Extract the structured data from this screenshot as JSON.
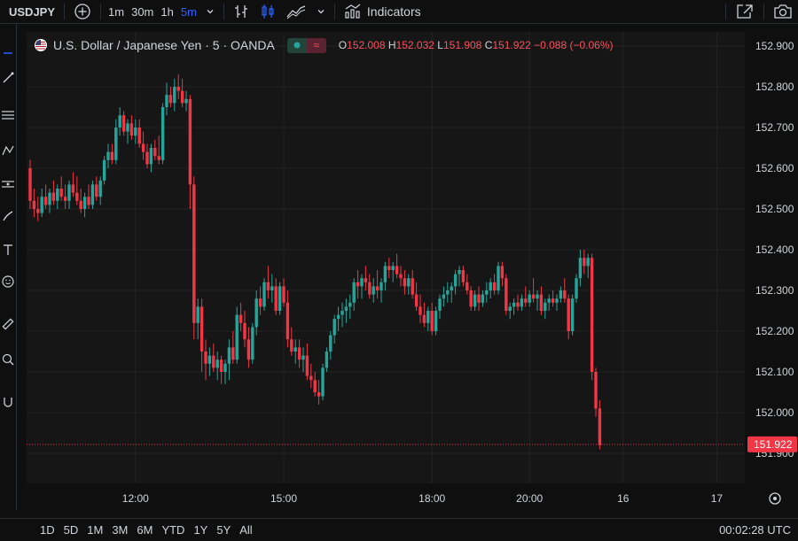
{
  "toolbar": {
    "symbol": "USDJPY",
    "intervals": [
      "1m",
      "30m",
      "1h",
      "5m"
    ],
    "active_interval": "5m",
    "indicators_label": "Indicators"
  },
  "legend": {
    "title": "U.S. Dollar / Japanese Yen · 5 · OANDA",
    "open_key": "O",
    "open": "152.008",
    "high_key": "H",
    "high": "152.032",
    "low_key": "L",
    "low": "151.908",
    "close_key": "C",
    "close": "151.922",
    "change": "−0.088 (−0.06%)",
    "badge_symbol": "≈"
  },
  "ranges": [
    "1D",
    "5D",
    "1M",
    "3M",
    "6M",
    "YTD",
    "1Y",
    "5Y",
    "All"
  ],
  "clock": "00:02:28 UTC",
  "colors": {
    "up": "#26a69a",
    "down": "#f23645",
    "accent": "#2962ff",
    "price_tag": "#f23645"
  },
  "chart_data": {
    "type": "candlestick",
    "y_ticks": [
      "152.900",
      "152.800",
      "152.700",
      "152.600",
      "152.500",
      "152.400",
      "152.300",
      "152.200",
      "152.100",
      "152.000",
      "151.900"
    ],
    "y_range": [
      151.86,
      152.92
    ],
    "x_ticks": [
      {
        "label": "12:00",
        "index": 27
      },
      {
        "label": "15:00",
        "index": 65
      },
      {
        "label": "18:00",
        "index": 103
      },
      {
        "label": "20:00",
        "index": 128
      },
      {
        "label": "16",
        "index": 152
      },
      {
        "label": "17",
        "index": 176
      }
    ],
    "last_price": "151.922",
    "candles": [
      [
        152.6,
        152.62,
        152.5,
        152.52
      ],
      [
        152.52,
        152.55,
        152.48,
        152.5
      ],
      [
        152.5,
        152.53,
        152.47,
        152.49
      ],
      [
        152.49,
        152.55,
        152.48,
        152.53
      ],
      [
        152.53,
        152.56,
        152.5,
        152.51
      ],
      [
        152.51,
        152.55,
        152.49,
        152.54
      ],
      [
        152.54,
        152.57,
        152.51,
        152.52
      ],
      [
        152.52,
        152.56,
        152.5,
        152.55
      ],
      [
        152.55,
        152.58,
        152.52,
        152.53
      ],
      [
        152.53,
        152.56,
        152.5,
        152.52
      ],
      [
        152.52,
        152.57,
        152.5,
        152.56
      ],
      [
        152.56,
        152.59,
        152.53,
        152.54
      ],
      [
        152.54,
        152.58,
        152.51,
        152.52
      ],
      [
        152.52,
        152.55,
        152.49,
        152.5
      ],
      [
        152.5,
        152.54,
        152.48,
        152.53
      ],
      [
        152.53,
        152.56,
        152.5,
        152.51
      ],
      [
        152.51,
        152.57,
        152.5,
        152.56
      ],
      [
        152.56,
        152.58,
        152.52,
        152.53
      ],
      [
        152.53,
        152.58,
        152.51,
        152.57
      ],
      [
        152.57,
        152.63,
        152.56,
        152.62
      ],
      [
        152.62,
        152.66,
        152.6,
        152.64
      ],
      [
        152.64,
        152.66,
        152.61,
        152.62
      ],
      [
        152.62,
        152.72,
        152.61,
        152.7
      ],
      [
        152.7,
        152.75,
        152.68,
        152.73
      ],
      [
        152.73,
        152.74,
        152.68,
        152.69
      ],
      [
        152.69,
        152.72,
        152.66,
        152.71
      ],
      [
        152.71,
        152.73,
        152.67,
        152.68
      ],
      [
        152.68,
        152.72,
        152.66,
        152.7
      ],
      [
        152.7,
        152.72,
        152.65,
        152.66
      ],
      [
        152.66,
        152.69,
        152.62,
        152.64
      ],
      [
        152.64,
        152.66,
        152.6,
        152.61
      ],
      [
        152.61,
        152.66,
        152.59,
        152.65
      ],
      [
        152.65,
        152.67,
        152.62,
        152.63
      ],
      [
        152.63,
        152.68,
        152.61,
        152.62
      ],
      [
        152.62,
        152.76,
        152.61,
        152.75
      ],
      [
        152.75,
        152.81,
        152.73,
        152.78
      ],
      [
        152.78,
        152.8,
        152.75,
        152.76
      ],
      [
        152.76,
        152.82,
        152.74,
        152.8
      ],
      [
        152.8,
        152.83,
        152.77,
        152.79
      ],
      [
        152.79,
        152.82,
        152.75,
        152.76
      ],
      [
        152.76,
        152.79,
        152.74,
        152.77
      ],
      [
        152.77,
        152.78,
        152.5,
        152.56
      ],
      [
        152.56,
        152.58,
        152.18,
        152.22
      ],
      [
        152.22,
        152.28,
        152.18,
        152.26
      ],
      [
        152.26,
        152.28,
        152.1,
        152.15
      ],
      [
        152.15,
        152.18,
        152.08,
        152.12
      ],
      [
        152.12,
        152.16,
        152.09,
        152.14
      ],
      [
        152.14,
        152.17,
        152.1,
        152.11
      ],
      [
        152.11,
        152.15,
        152.08,
        152.13
      ],
      [
        152.13,
        152.14,
        152.07,
        152.1
      ],
      [
        152.1,
        152.13,
        152.07,
        152.12
      ],
      [
        152.12,
        152.18,
        152.08,
        152.16
      ],
      [
        152.16,
        152.2,
        152.12,
        152.13
      ],
      [
        152.13,
        152.26,
        152.12,
        152.24
      ],
      [
        152.24,
        152.27,
        152.2,
        152.22
      ],
      [
        152.22,
        152.25,
        152.16,
        152.18
      ],
      [
        152.18,
        152.21,
        152.11,
        152.13
      ],
      [
        152.13,
        152.22,
        152.12,
        152.21
      ],
      [
        152.21,
        152.3,
        152.19,
        152.28
      ],
      [
        152.28,
        152.31,
        152.24,
        152.26
      ],
      [
        152.26,
        152.33,
        152.25,
        152.32
      ],
      [
        152.32,
        152.36,
        152.28,
        152.3
      ],
      [
        152.3,
        152.34,
        152.27,
        152.31
      ],
      [
        152.31,
        152.33,
        152.24,
        152.25
      ],
      [
        152.25,
        152.32,
        152.24,
        152.31
      ],
      [
        152.31,
        152.33,
        152.26,
        152.27
      ],
      [
        152.27,
        152.3,
        152.16,
        152.18
      ],
      [
        152.18,
        152.21,
        152.14,
        152.15
      ],
      [
        152.15,
        152.18,
        152.12,
        152.16
      ],
      [
        152.16,
        152.18,
        152.11,
        152.13
      ],
      [
        152.13,
        152.16,
        152.1,
        152.14
      ],
      [
        152.14,
        152.17,
        152.08,
        152.09
      ],
      [
        152.09,
        152.12,
        152.06,
        152.08
      ],
      [
        152.08,
        152.1,
        152.04,
        152.05
      ],
      [
        152.05,
        152.08,
        152.02,
        152.04
      ],
      [
        152.04,
        152.12,
        152.03,
        152.11
      ],
      [
        152.11,
        152.16,
        152.1,
        152.15
      ],
      [
        152.15,
        152.2,
        152.13,
        152.19
      ],
      [
        152.19,
        152.24,
        152.17,
        152.23
      ],
      [
        152.23,
        152.26,
        152.2,
        152.24
      ],
      [
        152.24,
        152.27,
        152.21,
        152.25
      ],
      [
        152.25,
        152.28,
        152.22,
        152.26
      ],
      [
        152.26,
        152.29,
        152.23,
        152.27
      ],
      [
        152.27,
        152.33,
        152.25,
        152.32
      ],
      [
        152.32,
        152.35,
        152.28,
        152.31
      ],
      [
        152.31,
        152.34,
        152.28,
        152.33
      ],
      [
        152.33,
        152.36,
        152.3,
        152.32
      ],
      [
        152.32,
        152.34,
        152.28,
        152.29
      ],
      [
        152.29,
        152.33,
        152.27,
        152.31
      ],
      [
        152.31,
        152.35,
        152.28,
        152.3
      ],
      [
        152.3,
        152.33,
        152.27,
        152.32
      ],
      [
        152.32,
        152.37,
        152.3,
        152.36
      ],
      [
        152.36,
        152.38,
        152.33,
        152.35
      ],
      [
        152.35,
        152.37,
        152.32,
        152.36
      ],
      [
        152.36,
        152.39,
        152.33,
        152.34
      ],
      [
        152.34,
        152.36,
        152.31,
        152.33
      ],
      [
        152.33,
        152.35,
        152.29,
        152.31
      ],
      [
        152.31,
        152.34,
        152.29,
        152.33
      ],
      [
        152.33,
        152.35,
        152.28,
        152.29
      ],
      [
        152.29,
        152.32,
        152.25,
        152.26
      ],
      [
        152.26,
        152.29,
        152.22,
        152.24
      ],
      [
        152.24,
        152.27,
        152.21,
        152.22
      ],
      [
        152.22,
        152.26,
        152.2,
        152.25
      ],
      [
        152.25,
        152.27,
        152.19,
        152.2
      ],
      [
        152.2,
        152.26,
        152.19,
        152.25
      ],
      [
        152.25,
        152.29,
        152.23,
        152.28
      ],
      [
        152.28,
        152.31,
        152.26,
        152.29
      ],
      [
        152.29,
        152.32,
        152.27,
        152.3
      ],
      [
        152.3,
        152.32,
        152.27,
        152.31
      ],
      [
        152.31,
        152.35,
        152.29,
        152.34
      ],
      [
        152.34,
        152.36,
        152.31,
        152.35
      ],
      [
        152.35,
        152.36,
        152.31,
        152.32
      ],
      [
        152.32,
        152.34,
        152.29,
        152.3
      ],
      [
        152.3,
        152.31,
        152.25,
        152.26
      ],
      [
        152.26,
        152.3,
        152.25,
        152.29
      ],
      [
        152.29,
        152.31,
        152.25,
        152.27
      ],
      [
        152.27,
        152.3,
        152.26,
        152.29
      ],
      [
        152.29,
        152.32,
        152.27,
        152.3
      ],
      [
        152.3,
        152.33,
        152.28,
        152.32
      ],
      [
        152.32,
        152.34,
        152.29,
        152.3
      ],
      [
        152.3,
        152.37,
        152.29,
        152.36
      ],
      [
        152.36,
        152.37,
        152.31,
        152.33
      ],
      [
        152.33,
        152.34,
        152.24,
        152.25
      ],
      [
        152.25,
        152.27,
        152.23,
        152.26
      ],
      [
        152.26,
        152.28,
        152.24,
        152.27
      ],
      [
        152.27,
        152.29,
        152.25,
        152.26
      ],
      [
        152.26,
        152.29,
        152.25,
        152.28
      ],
      [
        152.28,
        152.31,
        152.26,
        152.27
      ],
      [
        152.27,
        152.3,
        152.26,
        152.29
      ],
      [
        152.29,
        152.33,
        152.27,
        152.28
      ],
      [
        152.28,
        152.3,
        152.25,
        152.29
      ],
      [
        152.29,
        152.31,
        152.24,
        152.25
      ],
      [
        152.25,
        152.28,
        152.23,
        152.27
      ],
      [
        152.27,
        152.29,
        152.25,
        152.28
      ],
      [
        152.28,
        152.3,
        152.26,
        152.27
      ],
      [
        152.27,
        152.29,
        152.25,
        152.28
      ],
      [
        152.28,
        152.31,
        152.27,
        152.3
      ],
      [
        152.3,
        152.33,
        152.27,
        152.28
      ],
      [
        152.28,
        152.29,
        152.18,
        152.2
      ],
      [
        152.2,
        152.29,
        152.19,
        152.28
      ],
      [
        152.28,
        152.34,
        152.27,
        152.33
      ],
      [
        152.33,
        152.4,
        152.31,
        152.38
      ],
      [
        152.38,
        152.4,
        152.34,
        152.36
      ],
      [
        152.36,
        152.39,
        152.33,
        152.38
      ],
      [
        152.38,
        152.39,
        152.08,
        152.1
      ],
      [
        152.1,
        152.11,
        151.99,
        152.01
      ],
      [
        152.01,
        152.03,
        151.91,
        151.92
      ]
    ]
  }
}
